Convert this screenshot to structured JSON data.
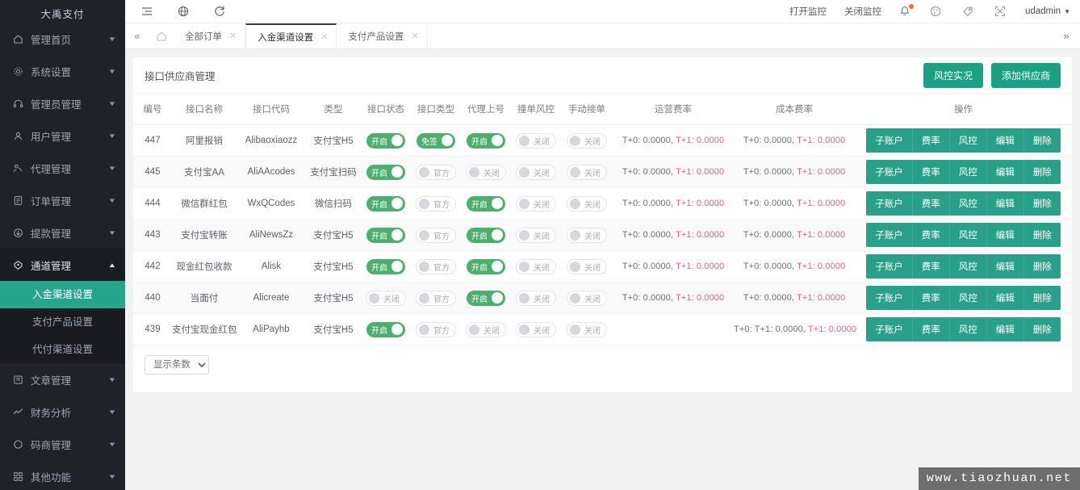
{
  "sidebar": {
    "brand": "大禹支付",
    "items": [
      {
        "label": "管理首页",
        "icon": "home-icon",
        "expanded": false
      },
      {
        "label": "系统设置",
        "icon": "gear-icon",
        "expanded": false
      },
      {
        "label": "管理员管理",
        "icon": "headset-icon",
        "expanded": false
      },
      {
        "label": "用户管理",
        "icon": "user-icon",
        "expanded": false
      },
      {
        "label": "代理管理",
        "icon": "agent-icon",
        "expanded": false
      },
      {
        "label": "订单管理",
        "icon": "list-icon",
        "expanded": false
      },
      {
        "label": "提款管理",
        "icon": "withdraw-icon",
        "expanded": false
      },
      {
        "label": "通道管理",
        "icon": "channel-icon",
        "expanded": true
      },
      {
        "label": "文章管理",
        "icon": "article-icon",
        "expanded": false
      },
      {
        "label": "财务分析",
        "icon": "analytics-icon",
        "expanded": false
      },
      {
        "label": "码商管理",
        "icon": "circle-icon",
        "expanded": false
      },
      {
        "label": "其他功能",
        "icon": "grid-icon",
        "expanded": false
      }
    ],
    "submenu": [
      {
        "label": "入金渠道设置",
        "active": true
      },
      {
        "label": "支付产品设置",
        "active": false
      },
      {
        "label": "代付渠道设置",
        "active": false
      }
    ]
  },
  "topbar": {
    "icons": [
      "menu-icon",
      "globe-icon",
      "refresh-icon"
    ],
    "open_monitor": "打开监控",
    "close_monitor": "关闭监控",
    "right_icons": [
      "bell-icon",
      "theme-icon",
      "tag-icon",
      "fullscreen-icon"
    ],
    "user": "udadmin"
  },
  "tabs": {
    "collapse_icon": "double-chevron-left-icon",
    "home_icon": "home-icon",
    "more_icon": "double-chevron-right-icon",
    "items": [
      {
        "label": "全部订单",
        "active": false,
        "closable": true
      },
      {
        "label": "入金渠道设置",
        "active": true,
        "closable": true
      },
      {
        "label": "支付产品设置",
        "active": false,
        "closable": true
      }
    ]
  },
  "card": {
    "title": "接口供应商管理",
    "buttons": [
      {
        "label": "风控实况",
        "name": "risk-live-button"
      },
      {
        "label": "添加供应商",
        "name": "add-supplier-button"
      }
    ]
  },
  "table": {
    "headers": [
      "编号",
      "接口名称",
      "接口代码",
      "类型",
      "接口状态",
      "接口类型",
      "代理上号",
      "撞单风控",
      "手动接单",
      "运营费率",
      "成本费率",
      "操作"
    ],
    "ops": [
      "子账户",
      "费率",
      "风控",
      "编辑",
      "删除"
    ],
    "rows": [
      {
        "id": "447",
        "name": "阿里报销",
        "code": "Alibaoxiaozz",
        "type": "支付宝H5",
        "status": {
          "label": "开启",
          "on": true
        },
        "iface_type": {
          "label": "免签",
          "on": true
        },
        "agent": {
          "label": "开启",
          "on": true
        },
        "collide": {
          "label": "关闭",
          "on": false
        },
        "manual": {
          "label": "关闭",
          "on": false
        },
        "op_rate": {
          "t0": "T+0: 0.0000,",
          "t1": "T+1: 0.0000"
        },
        "cost_rate": {
          "t0": "T+0: 0.0000,",
          "t1": "T+1: 0.0000"
        }
      },
      {
        "id": "445",
        "name": "支付宝AA",
        "code": "AliAAcodes",
        "type": "支付宝扫码",
        "status": {
          "label": "开启",
          "on": true
        },
        "iface_type": {
          "label": "官方",
          "on": false
        },
        "agent": {
          "label": "关闭",
          "on": false
        },
        "collide": {
          "label": "关闭",
          "on": false
        },
        "manual": {
          "label": "关闭",
          "on": false
        },
        "op_rate": {
          "t0": "T+0: 0.0000,",
          "t1": "T+1: 0.0000"
        },
        "cost_rate": {
          "t0": "T+0: 0.0000,",
          "t1": "T+1: 0.0000"
        }
      },
      {
        "id": "444",
        "name": "微信群红包",
        "code": "WxQCodes",
        "type": "微信扫码",
        "status": {
          "label": "开启",
          "on": true
        },
        "iface_type": {
          "label": "官方",
          "on": false
        },
        "agent": {
          "label": "开启",
          "on": true
        },
        "collide": {
          "label": "关闭",
          "on": false
        },
        "manual": {
          "label": "关闭",
          "on": false
        },
        "op_rate": {
          "t0": "T+0: 0.0000,",
          "t1": "T+1: 0.0000"
        },
        "cost_rate": {
          "t0": "T+0: 0.0000,",
          "t1": "T+1: 0.0000"
        }
      },
      {
        "id": "443",
        "name": "支付宝转账",
        "code": "AliNewsZz",
        "type": "支付宝H5",
        "status": {
          "label": "开启",
          "on": true
        },
        "iface_type": {
          "label": "官方",
          "on": false
        },
        "agent": {
          "label": "开启",
          "on": true
        },
        "collide": {
          "label": "关闭",
          "on": false
        },
        "manual": {
          "label": "关闭",
          "on": false
        },
        "op_rate": {
          "t0": "T+0: 0.0000,",
          "t1": "T+1: 0.0000"
        },
        "cost_rate": {
          "t0": "T+0: 0.0000,",
          "t1": "T+1: 0.0000"
        }
      },
      {
        "id": "442",
        "name": "现金红包收款",
        "code": "Alisk",
        "type": "支付宝H5",
        "status": {
          "label": "开启",
          "on": true
        },
        "iface_type": {
          "label": "官方",
          "on": false
        },
        "agent": {
          "label": "开启",
          "on": true
        },
        "collide": {
          "label": "关闭",
          "on": false
        },
        "manual": {
          "label": "关闭",
          "on": false
        },
        "op_rate": {
          "t0": "T+0: 0.0000,",
          "t1": "T+1: 0.0000"
        },
        "cost_rate": {
          "t0": "T+0: 0.0000,",
          "t1": "T+1: 0.0000"
        }
      },
      {
        "id": "440",
        "name": "当面付",
        "code": "Alicreate",
        "type": "支付宝H5",
        "status": {
          "label": "关闭",
          "on": false
        },
        "iface_type": {
          "label": "官方",
          "on": false
        },
        "agent": {
          "label": "开启",
          "on": true
        },
        "collide": {
          "label": "关闭",
          "on": false
        },
        "manual": {
          "label": "关闭",
          "on": false
        },
        "op_rate": {
          "t0": "T+0: 0.0000,",
          "t1": "T+1: 0.0000"
        },
        "cost_rate": {
          "t0": "T+0: 0.0000,",
          "t1": "T+1: 0.0000"
        }
      },
      {
        "id": "439",
        "name": "支付宝现金红包",
        "code": "AliPayhb",
        "type": "支付宝H5",
        "status": {
          "label": "开启",
          "on": true
        },
        "iface_type": {
          "label": "官方",
          "on": false
        },
        "agent": {
          "label": "关闭",
          "on": false
        },
        "collide": {
          "label": "关闭",
          "on": false
        },
        "manual": {
          "label": "关闭",
          "on": false
        },
        "op_rate": {
          "t0": "",
          "t1": ""
        },
        "cost_rate": {
          "t0": "T+0: T+1: 0.0000,",
          "t1": "T+1: 0.0000"
        }
      }
    ]
  },
  "footer": {
    "page_size_label": "显示条数"
  },
  "watermark": "www.tiaozhuan.net",
  "colors": {
    "sidebar_bg": "#20222a",
    "active_green": "#27a58c",
    "button_teal": "#1aa083",
    "op_teal": "#28a08a",
    "switch_on": "#4caf6d",
    "rate_pink": "#e8607d"
  }
}
